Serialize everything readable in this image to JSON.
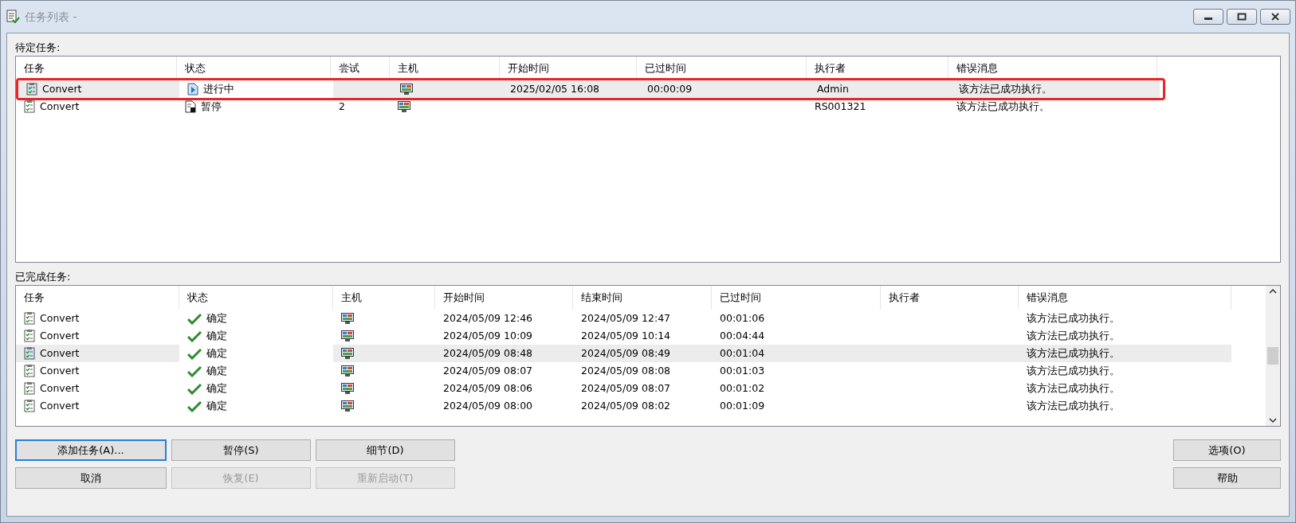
{
  "window": {
    "title": "任务列表 -"
  },
  "pending": {
    "label": "待定任务:",
    "columns": [
      "任务",
      "状态",
      "尝试",
      "主机",
      "开始时间",
      "已过时间",
      "执行者",
      "错误消息"
    ],
    "rows": [
      {
        "selected": true,
        "highlighted": true,
        "task": "Convert",
        "kind": "running",
        "status": "进行中",
        "tries": "",
        "start": "2025/02/05 16:08",
        "elapsed": "00:00:09",
        "executor": "Admin",
        "message": "该方法已成功执行。"
      },
      {
        "selected": false,
        "highlighted": false,
        "task": "Convert",
        "kind": "paused",
        "status": "暂停",
        "tries": "2",
        "start": "",
        "elapsed": "",
        "executor": "RS001321",
        "message": "该方法已成功执行。"
      }
    ]
  },
  "completed": {
    "label": "已完成任务:",
    "columns": [
      "任务",
      "状态",
      "主机",
      "开始时间",
      "结束时间",
      "已过时间",
      "执行者",
      "错误消息"
    ],
    "rows": [
      {
        "selected": false,
        "task": "Convert",
        "kind": "ok",
        "status": "确定",
        "start": "2024/05/09 12:46",
        "end": "2024/05/09 12:47",
        "elapsed": "00:01:06",
        "message": "该方法已成功执行。"
      },
      {
        "selected": false,
        "task": "Convert",
        "kind": "ok",
        "status": "确定",
        "start": "2024/05/09 10:09",
        "end": "2024/05/09 10:14",
        "elapsed": "00:04:44",
        "message": "该方法已成功执行。"
      },
      {
        "selected": true,
        "task": "Convert",
        "kind": "ok",
        "status": "确定",
        "start": "2024/05/09 08:48",
        "end": "2024/05/09 08:49",
        "elapsed": "00:01:04",
        "message": "该方法已成功执行。"
      },
      {
        "selected": false,
        "task": "Convert",
        "kind": "ok",
        "status": "确定",
        "start": "2024/05/09 08:07",
        "end": "2024/05/09 08:08",
        "elapsed": "00:01:03",
        "message": "该方法已成功执行。"
      },
      {
        "selected": false,
        "task": "Convert",
        "kind": "ok",
        "status": "确定",
        "start": "2024/05/09 08:06",
        "end": "2024/05/09 08:07",
        "elapsed": "00:01:02",
        "message": "该方法已成功执行。"
      },
      {
        "selected": false,
        "task": "Convert",
        "kind": "ok",
        "status": "确定",
        "start": "2024/05/09 08:00",
        "end": "2024/05/09 08:02",
        "elapsed": "00:01:09",
        "message": "该方法已成功执行。"
      }
    ]
  },
  "buttons_left": [
    {
      "label": "添加任务(A)...",
      "disabled": false,
      "focused": true
    },
    {
      "label": "暂停(S)",
      "disabled": false,
      "focused": false
    },
    {
      "label": "细节(D)",
      "disabled": false,
      "focused": false
    },
    {
      "label": "取消",
      "disabled": false,
      "focused": false
    },
    {
      "label": "恢复(E)",
      "disabled": true,
      "focused": false
    },
    {
      "label": "重新启动(T)",
      "disabled": true,
      "focused": false
    }
  ],
  "buttons_right": [
    {
      "label": "选项(O)",
      "disabled": false,
      "focused": false
    },
    {
      "label": "帮助",
      "disabled": false,
      "focused": false
    }
  ]
}
